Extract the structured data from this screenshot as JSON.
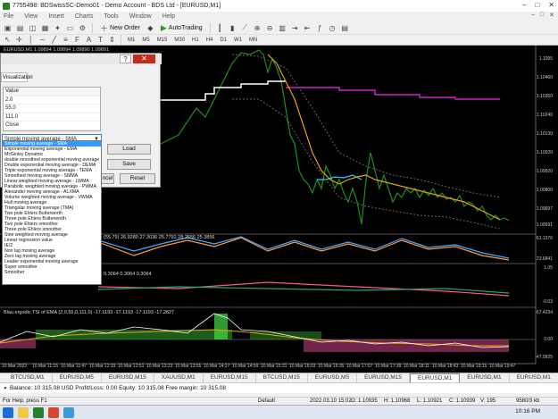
{
  "window": {
    "title": "7755498: BDSwissSC-Demo01 - Demo Account - BDS Ltd - [EURUSD,M1]",
    "controls": [
      "–",
      "□",
      "✕"
    ]
  },
  "menu": {
    "items": [
      "File",
      "View",
      "Insert",
      "Charts",
      "Tools",
      "Window",
      "Help"
    ],
    "doc_controls": [
      "–",
      "□",
      "✕"
    ]
  },
  "toolbar": {
    "new_order": "New Order",
    "autotrading": "AutoTrading",
    "timeframes": [
      "M1",
      "M5",
      "M15",
      "M30",
      "H1",
      "H4",
      "D1",
      "W1",
      "MN"
    ]
  },
  "chart": {
    "info": "EURUSD,M1  1.09894 1.09894 1.09890 1.09891",
    "pane1_label": "Bias ergodic TSI of EMA (2,0.55,0,111,0) 27.3036 27.7792 28.2556 26.3856",
    "pane1_partial": "(55.79) 26.9280 27.3036 25.7792 28.2556 25.3856",
    "pane2_label": "0.3064 0.3064 0.3064",
    "pane3_label": "Blau ergodic TSI of EMA (2,0.55,0,111,0) -17.1193 -17.1193 -17.1193 -17.2827",
    "price_axis": [
      "1.10160",
      "1.10050",
      "1.09960",
      "1.09850",
      "1.09740",
      "1.09630",
      "1.09520",
      "1.09410",
      "1.09300",
      "1.09190",
      "1.09080",
      "1.08970"
    ],
    "price_right": [
      "1.1095",
      "1.10460",
      "1.10350",
      "1.10240",
      "1.10130",
      "1.10020",
      "1.09920",
      "1.09800",
      "1.09697",
      "1.09591"
    ],
    "pane1_axis": [
      "61.1376",
      "23.6841"
    ],
    "pane2_axis": [
      "1.05",
      "-0.03"
    ],
    "pane3_axis": [
      "67.4234",
      "0.00",
      "-47.0925"
    ],
    "time_axis": [
      "10 Mar 2022",
      "10 Mar 11:15",
      "10 Mar 11:47",
      "10 Mar 12:19",
      "10 Mar 12:51",
      "10 Mar 13:23",
      "10 Mar 13:55",
      "10 Mar 14:27",
      "10 Mar 14:59",
      "10 Mar 15:31",
      "10 Mar 16:03",
      "10 Mar 16:35",
      "10 Mar 17:07",
      "10 Mar 17:39",
      "10 Mar 18:11",
      "10 Mar 18:43",
      "10 Mar 19:15",
      "10 Mar 19:47"
    ]
  },
  "dialog": {
    "tab": "Visualization",
    "param_header": "Value",
    "params": [
      "2.0",
      "55.0",
      "111.0",
      "Close"
    ],
    "selected": "Simple moving average - SMA",
    "buttons": {
      "load": "Load",
      "save": "Save",
      "cancel": "ncel",
      "reset": "Reset"
    },
    "help": "?",
    "close": "✕",
    "options": [
      "Simple moving average - SMA",
      "Exponential moving average - EMA",
      "McGinley Dynamic",
      "double smoothed exponential moving average",
      "Double exponential moving average - DEMA",
      "Triple exponential moving average - TEMA",
      "Smoothed moving average - SMMA",
      "Linear weighted moving average - LWMA",
      "Parabolic weighted moving average - PWMA",
      "Alexander moving average - ALXMA",
      "Volume weighted moving average - VWMA",
      "Hull moving average",
      "Triangular moving average (TMA)",
      "Two pole Ehlers Butterworth",
      "Three pole Ehlers Butterworth",
      "Two pole Ehlers smoother",
      "Three pole Ehlers smoother",
      "Sine weighted moving average",
      "Linear regression value",
      "IE/2",
      "Non lag moving average",
      "Zero lag moving average",
      "Leader exponential moving average",
      "Super smoother",
      "Smoother"
    ]
  },
  "symbol_tabs": [
    "BTCUSD,M1",
    "EURUSD,M5",
    "EURUSD,M15",
    "XAUUSD,M1",
    "EURUSD,M15",
    "BTCUSD,M15",
    "EURUSD,M5",
    "EURUSD,M15",
    "EURUSD,M1",
    "EURUSD,M1",
    "EURUSD,M1"
  ],
  "active_tab_index": 8,
  "balance": "Balance: 10 315.08 USD  Profit/Loss: 0.00  Equity: 10 315.08  Free margin: 10 315.08",
  "status": {
    "help": "For Help, press F1",
    "profile": "Default",
    "datetime": "2022.03.10 15:02",
    "open": "O: 1.10935",
    "high": "H: 1.10968",
    "low": "L: 1.10921",
    "close": "C: 1.10939",
    "volume": "V: 195",
    "traffic": "9580/3 kb"
  },
  "clock": "10:16 PM"
}
